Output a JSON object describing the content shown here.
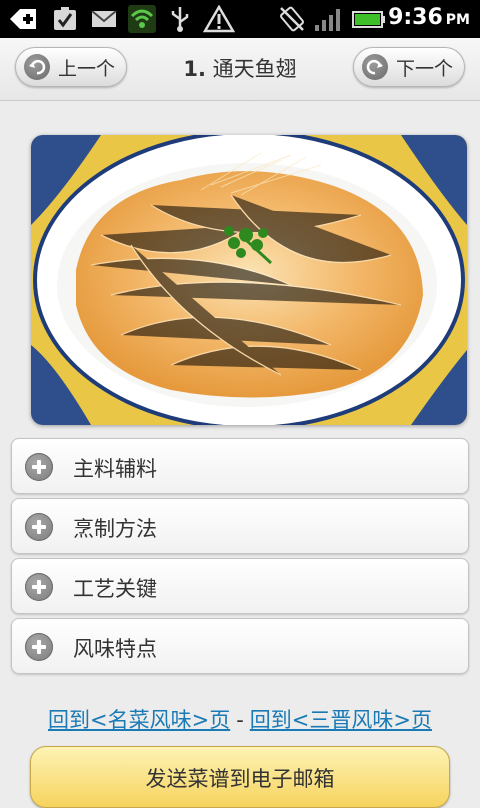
{
  "status_bar": {
    "time": "9:36",
    "ampm": "PM",
    "icons": [
      "add-icon",
      "checkbox-icon",
      "mail-icon",
      "wifi-icon",
      "usb-icon",
      "warning-icon",
      "rotation-lock-icon",
      "signal-icon",
      "battery-icon"
    ],
    "colors": {
      "wifi": "#5cc84b",
      "battery": "#3fbf2a"
    }
  },
  "header": {
    "prev_label": "上一个",
    "next_label": "下一个",
    "title_number": "1.",
    "title_text": "通天鱼翅"
  },
  "sections": [
    {
      "label": "主料辅料"
    },
    {
      "label": "烹制方法"
    },
    {
      "label": "工艺关键"
    },
    {
      "label": "风味特点"
    }
  ],
  "links": {
    "back_famous": "回到<名菜风味>页",
    "separator": "-",
    "back_sanjin": "回到<三晋风味>页"
  },
  "send_button": "发送菜谱到电子邮箱",
  "colors": {
    "link": "#1a7ab5",
    "send_button": "#f6d35e"
  }
}
